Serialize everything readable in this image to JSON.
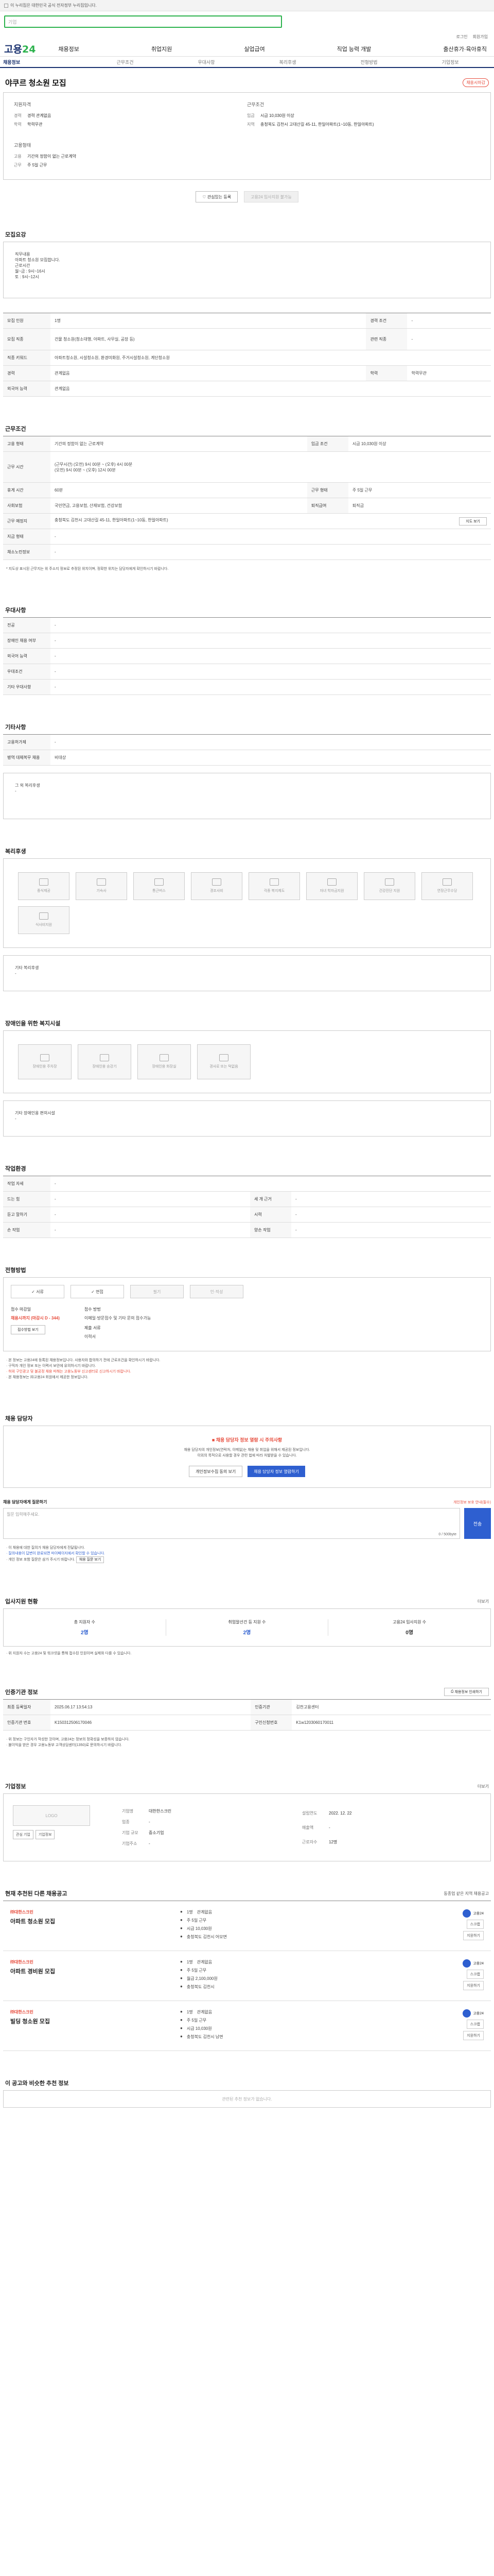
{
  "topbar": {
    "text": "이 누리집은 대한민국 공식 전자정부 누리집입니다."
  },
  "search": {
    "placeholder": "기업"
  },
  "toplinks": [
    "로그인",
    "회원가입"
  ],
  "logo": {
    "main": "고용",
    "accent": "24"
  },
  "gnb": [
    "채용정보",
    "취업지원",
    "실업급여",
    "직업 능력 개발",
    "출산휴가·육아휴직"
  ],
  "subnav": [
    "채용정보",
    "근무조건",
    "우대사항",
    "복리후생",
    "전형방법",
    "기업정보"
  ],
  "title": "야쿠르 청소원 모집",
  "badge": "채용시마감",
  "summary": {
    "left_heading": "지원자격",
    "left": [
      {
        "k": "경력",
        "v": "경력 관계없음"
      },
      {
        "k": "학력",
        "v": "학력무관"
      }
    ],
    "left_heading2": "고용형태",
    "left2": [
      {
        "k": "고용",
        "v": "기간의 정함이 없는 근로계약"
      },
      {
        "k": "근무",
        "v": "주 5일 근무"
      }
    ],
    "right_heading": "근무조건",
    "right": [
      {
        "k": "임금",
        "v": "시급 10,030원 이상"
      },
      {
        "k": "지역",
        "v": "충청북도 김천시 고대산길 45-11, 한일아파트(1~10동, 한일아파트)"
      }
    ]
  },
  "actions": {
    "interest": "관심있는 등록",
    "apply": "고용24 입사지원 불가능"
  },
  "sec_recruit": {
    "title": "모집요강",
    "desc_lines": [
      "직무내용",
      "아파트 청소원 모집합니다.",
      "",
      "근로시간",
      "월~금 : 9시~16시",
      "토 : 9시~12시"
    ],
    "rows": [
      [
        {
          "k": "모집 인원",
          "v": "1명"
        },
        {
          "k": "경력 조건",
          "v": "-"
        }
      ],
      [
        {
          "k": "모집 직종",
          "v": "건물 청소원(청소대행, 아파트, 사무실, 공장 등)"
        },
        {
          "k": "관련 직종",
          "v": "-"
        }
      ],
      [
        {
          "k": "직종 키워드",
          "v": "아파트청소원, 시설청소원, 환경미화원, 주거시설청소원, 계단청소원"
        }
      ],
      [
        {
          "k": "경력",
          "v": "관계없음"
        },
        {
          "k": "학력",
          "v": "학력무관"
        }
      ],
      [
        {
          "k": "외국어 능력",
          "v": "관계없음"
        }
      ]
    ]
  },
  "sec_work": {
    "title": "근무조건",
    "rows": [
      [
        {
          "k": "고용 형태",
          "v": "기간의 정함이 없는 근로계약"
        },
        {
          "k": "임금 조건",
          "v": "시급 10,030원 이상"
        }
      ],
      [
        {
          "k": "근무 시간",
          "v": "(근무시간) (오전) 9시 00분 ~ (오후) 4시 00분\n(오전) 9시 00분 ~ (오후) 12시 00분"
        }
      ],
      [
        {
          "k": "휴게 시간",
          "v": "60분"
        },
        {
          "k": "근무 형태",
          "v": "주 5일 근무"
        }
      ],
      [
        {
          "k": "사회보험",
          "v": "국민연금, 고용보험, 산재보험, 건강보험"
        },
        {
          "k": "퇴직급여",
          "v": "퇴직금"
        }
      ],
      [
        {
          "k": "근무 예정지",
          "v": "충청북도 김천시 고대산길 45-11, 한일아파트(1~10동, 한일아파트)"
        }
      ],
      [
        {
          "k": "지금 형태",
          "v": "-"
        }
      ],
      [
        {
          "k": "채소노런정보",
          "v": "-"
        }
      ]
    ],
    "map_button": "지도 보기",
    "note": "* 지도상 표시된 근무지는 위 주소지 정보로 추정된 위치이며, 정확한 위치는 담당자에게 확인하시기 바랍니다."
  },
  "sec_pref": {
    "title": "우대사항",
    "rows": [
      "전공",
      "장애인 채용 여부",
      "외국어 능력",
      "우대조건",
      "기타 우대사항"
    ]
  },
  "sec_etc": {
    "title": "기타사항",
    "rows": [
      {
        "k": "고용허가제",
        "v": "-"
      },
      {
        "k": "병역 대체복무 채용",
        "v": "비대상"
      }
    ],
    "note_title": "그 외 복리후생",
    "note_value": "-"
  },
  "sec_welfare": {
    "title": "복리후생",
    "icons": [
      "중식제공",
      "기숙사",
      "통근버스",
      "경조사비",
      "각종 복지제도",
      "자녀 학자금지원",
      "건강진단 지원",
      "연장근무수당",
      "식사비지원"
    ],
    "other_title": "기타 복리후생",
    "other_value": "-"
  },
  "sec_disability": {
    "title": "장애인을 위한 복지시설",
    "icons": [
      "장애인용 주차장",
      "장애인용 승강기",
      "장애인용 화장실",
      "경사로 또는 턱없음"
    ],
    "other_title": "기타 장애인용 편의시설",
    "other_value": "-"
  },
  "sec_env": {
    "title": "작업환경",
    "rows": [
      [
        {
          "k": "작업 자세",
          "v": "-"
        }
      ],
      [
        {
          "k": "드는 힘",
          "v": "-"
        },
        {
          "k": "세 개 근거",
          "v": "-"
        }
      ],
      [
        {
          "k": "듣고 말하기",
          "v": "-"
        },
        {
          "k": "시력",
          "v": "-"
        }
      ],
      [
        {
          "k": "손 작업",
          "v": "-"
        },
        {
          "k": "양손 작업",
          "v": "-"
        }
      ]
    ]
  },
  "sec_apply": {
    "title": "전형방법",
    "methods": [
      {
        "label": "서류",
        "on": true
      },
      {
        "label": "면접",
        "on": true
      },
      {
        "label": "필기",
        "on": false
      },
      {
        "label": "인·적성",
        "on": false
      }
    ],
    "deadline_label": "접수 마감일",
    "deadline_value": "채용시까지 (마감시 D - 344)",
    "register_button": "접수방법 보기",
    "method_label": "접수 방법",
    "method_value": "이메일·방문접수 및 기타 문의 접수가능",
    "docs_label": "제출 서류",
    "docs_value": "이력서",
    "notes": [
      "· 본 정보는 고용24에 등록된 채용정보입니다. 사용자와 합의하기 전에 근로조건을 확인하시기 바랍니다.",
      "· 구직자 개인 정보 또는 이력서 보안에 유의하시기 바랍니다.",
      "· 허위 구인광고 및 불공정 채용 피해는 고용노동부 신고센터로 신고하시기 바랍니다.",
      "· 본 채용정보는 ㈜고용24 회원에서 제공한 정보입니다."
    ]
  },
  "sec_manager": {
    "title": "채용 담당자",
    "alert": "채용 담당자 정보 열람 시 주의사항",
    "desc1": "채용 담당자의 개인정보(연락처, 이메일)는 채용 및 취업을 위해서 제공된 정보입니다.",
    "desc2": "이외의 목적으로 사용할 경우 관련 법에 따라 처벌받을 수 있습니다.",
    "btn_open": "개인정보수집 동의 보기",
    "btn_view": "채용 담당자 정보 열람하기",
    "inq_title": "채용 담당자에게 질문하기",
    "inq_hint": "개인정보 보호 안내(필수)",
    "inq_placeholder": "질문 입력해주세요.",
    "inq_count": "0 / 500byte",
    "inq_send": "전송",
    "inq_notes": [
      "· 이 채용에 대한 질의가 채용 담당자에게 전달됩니다.",
      "· 질의내용이 답변이 완료되면 마이페이지에서 확인할 수 있습니다.",
      "· 개인 정보 포함 질문은 삼가 주시기 바랍니다."
    ],
    "inq_link": "채용 질문 보기"
  },
  "sec_stats": {
    "title": "입사지원 현황",
    "more": "더보기",
    "items": [
      {
        "label": "총 지원자 수",
        "value": "2명",
        "blue": true
      },
      {
        "label": "취업알선건 등 지원 수",
        "value": "2명",
        "blue": true
      },
      {
        "label": "고용24 입사지원 수",
        "value": "0명",
        "blue": false
      }
    ],
    "note": "· 위 지원자 수는 고용24 및 워크넷을 통해 접수된 인원이며 실제와 다를 수 있습니다."
  },
  "sec_info": {
    "title": "인증기관 정보",
    "print": "채용정보 인쇄하기",
    "rows": [
      [
        {
          "k": "최종 등록일자",
          "v": "2025.06.17 13:54:13"
        },
        {
          "k": "인증기관",
          "v": "김천고용센터"
        }
      ],
      [
        {
          "k": "인증기관 번호",
          "v": "K150312506170046"
        },
        {
          "k": "구인신청번호",
          "v": "K1w1203060170011"
        }
      ]
    ],
    "notes": [
      "· 위 정보는 구인자가 작성한 것이며, 고용24는 정보의 정확성을 보증하지 않습니다.",
      "· 불이익을 받은 경우 고용노동부 고객상담센터(1350)로 문의하시기 바랍니다."
    ]
  },
  "sec_company": {
    "title": "기업정보",
    "more": "더보기",
    "logo_text": "LOGO",
    "btn1": "관심 기업",
    "btn2": "기업정보",
    "left": [
      {
        "k": "기업명",
        "v": "대한한스크린"
      },
      {
        "k": "업종",
        "v": "-"
      },
      {
        "k": "기업 규모",
        "v": "중소기업"
      },
      {
        "k": "기업주소",
        "v": "-"
      }
    ],
    "right": [
      {
        "k": "설립연도",
        "v": "2022. 12. 22"
      },
      {
        "k": "매출액",
        "v": "-"
      },
      {
        "k": "근로자수",
        "v": "12명"
      }
    ]
  },
  "sec_jobs": {
    "title": "현재 추천된 다른 채용공고",
    "note": "동종업 같은 지역 채용공고",
    "items": [
      {
        "comp": "㈜대한스크린",
        "title": "아파트 청소원 모집",
        "c1": "1명",
        "c2": "관계없음",
        "c3": "주 5일 근무",
        "c4": "시급 10,030원",
        "c5": "충청북도 김천시 어모면",
        "who": "고용24"
      },
      {
        "comp": "㈜대한스크린",
        "title": "아파트 경비원 모집",
        "c1": "1명",
        "c2": "관계없음",
        "c3": "주 5일 근무",
        "c4": "월급 2,100,000원",
        "c5": "충청북도 김천시",
        "who": "고용24"
      },
      {
        "comp": "㈜대한스크린",
        "title": "빌딩 청소원 모집",
        "c1": "1명",
        "c2": "관계없음",
        "c3": "주 5일 근무",
        "c4": "시급 10,030원",
        "c5": "충청북도 김천시 남면",
        "who": "고용24"
      }
    ],
    "btn_save": "스크랩",
    "btn_apply": "지원하기"
  },
  "sec_similar": {
    "title": "이 공고와 비슷한 추천 정보",
    "empty": "관련된 추천 정보가 없습니다."
  }
}
